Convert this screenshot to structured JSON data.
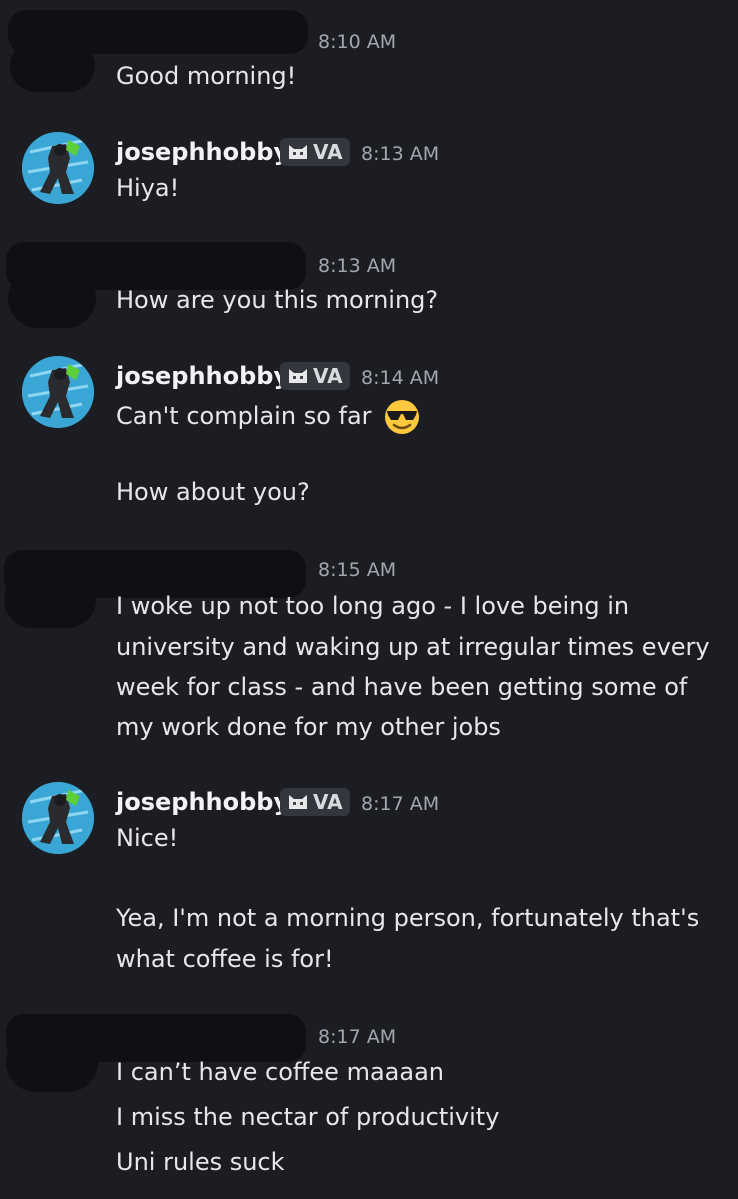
{
  "messages": [
    {
      "user": "",
      "time": "8:10 AM",
      "lines": [
        "Good morning!"
      ]
    },
    {
      "user": "josephhobby",
      "badge": "VA",
      "time": "8:13 AM",
      "lines": [
        "Hiya!"
      ]
    },
    {
      "user": "",
      "time": "8:13 AM",
      "lines": [
        "How are you this morning?"
      ]
    },
    {
      "user": "josephhobby",
      "badge": "VA",
      "time": "8:14 AM",
      "lines": [
        "Can't complain so far",
        "How about you?"
      ]
    },
    {
      "user": "",
      "time": "8:15 AM",
      "lines": [
        "I woke up not too long ago - I love being in",
        "university and waking up at irregular times every",
        "week for class - and have been getting some of",
        "my work done for my other jobs"
      ]
    },
    {
      "user": "josephhobby",
      "badge": "VA",
      "time": "8:17 AM",
      "lines": [
        "Nice!",
        "Yea, I'm not a morning person, fortunately that's",
        "what coffee is for!"
      ]
    },
    {
      "user": "",
      "time": "8:17 AM",
      "lines": [
        "I can’t have coffee maaaan",
        "I miss the nectar of productivity",
        "Uni rules suck"
      ]
    }
  ],
  "emoji": "sunglasses-emoji",
  "colors": {
    "background": "#1c1d22",
    "text": "#e6e7ea",
    "timestamp": "#a3a6ad",
    "badge": "#34363d",
    "avatar": "#3aa6d6"
  }
}
